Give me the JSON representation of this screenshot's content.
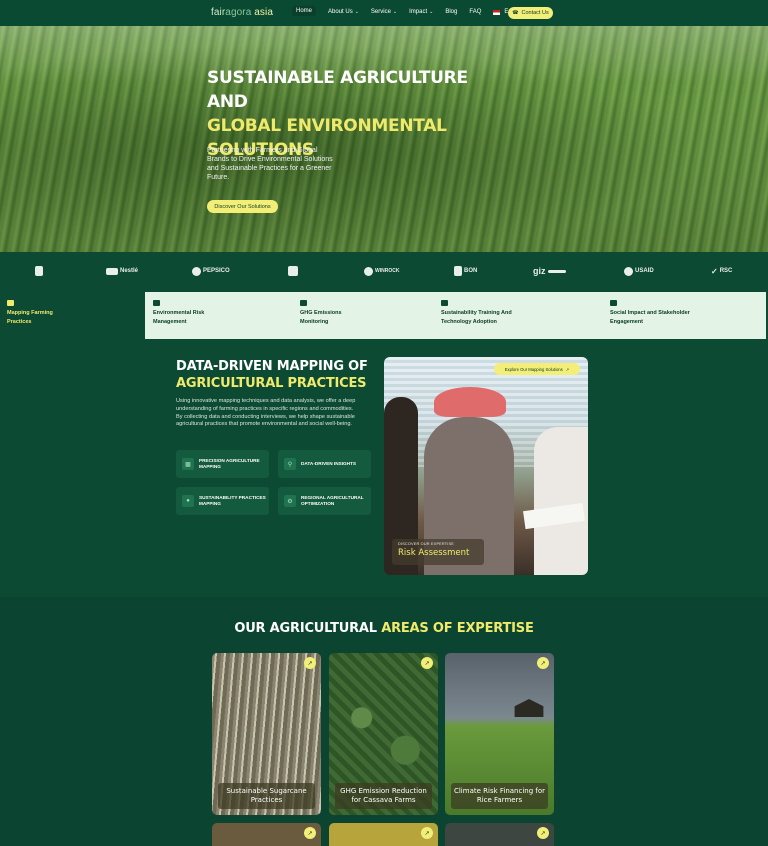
{
  "nav": {
    "logo": {
      "a": "fair",
      "b": "agora",
      "c": " asia"
    },
    "items": [
      {
        "label": "Home",
        "has_menu": false
      },
      {
        "label": "About Us",
        "has_menu": true
      },
      {
        "label": "Service",
        "has_menu": true
      },
      {
        "label": "Impact",
        "has_menu": true
      },
      {
        "label": "Blog",
        "has_menu": false
      },
      {
        "label": "FAQ",
        "has_menu": false
      },
      {
        "label": "English",
        "has_menu": true
      }
    ],
    "contact_label": "Contact Us",
    "chevron": "⌄"
  },
  "hero": {
    "title_line1": "SUSTAINABLE AGRICULTURE AND",
    "title_highlight": "GLOBAL ENVIRONMENTAL SOLUTIONS",
    "subtitle": "Partnering with Farmers and Global Brands to Drive Environmental Solutions and Sustainable Practices for a Greener Future.",
    "cta_label": "Discover Our Solutions"
  },
  "partners": [
    {
      "label": "",
      "icon": "panda-logo-icon"
    },
    {
      "label": "Nestlé",
      "icon": "nestle-logo-icon"
    },
    {
      "label": "PEPSICO",
      "icon": "pepsico-logo-icon"
    },
    {
      "label": "",
      "icon": "partner-logo-icon"
    },
    {
      "label": "WINROCK",
      "icon": "winrock-logo-icon"
    },
    {
      "label": "BON",
      "icon": "bonsucro-logo-icon"
    },
    {
      "label": "giz",
      "icon": "giz-logo-icon"
    },
    {
      "label": "USAID",
      "icon": "usaid-logo-icon"
    },
    {
      "label": "RSC",
      "icon": "rsc-logo-icon"
    }
  ],
  "tabs": [
    {
      "label": "Mapping Farming Practices",
      "active": true
    },
    {
      "label": "Environmental Risk Management",
      "active": false
    },
    {
      "label": "GHG Emissions Monitoring",
      "active": false
    },
    {
      "label": "Sustainability Training And Technology Adoption",
      "active": false
    },
    {
      "label": "Social Impact and Stakeholder Engagement",
      "active": false
    }
  ],
  "mapping": {
    "title_line1": "DATA-DRIVEN MAPPING OF",
    "title_highlight": "AGRICULTURAL PRACTICES",
    "description": "Using innovative mapping techniques and data analysis, we offer a deep understanding of farming practices in specific regions and commodities. By collecting data and conducting interviews, we help shape sustainable agricultural practices that promote environmental and social well-being.",
    "features": [
      {
        "label": "PRECISION AGRICULTURE MAPPING",
        "icon": "chart-icon"
      },
      {
        "label": "DATA-DRIVEN INSIGHTS",
        "icon": "search-icon"
      },
      {
        "label": "SUSTAINABILITY PRACTICES MAPPING",
        "icon": "people-icon"
      },
      {
        "label": "REGIONAL AGRICULTURAL OPTIMIZATION",
        "icon": "gear-icon"
      }
    ],
    "photo": {
      "explore_label": "Explore Our Mapping Solutions",
      "caption_small": "DISCOVER OUR EXPERTISE",
      "caption_big": "Risk Assessment"
    }
  },
  "expertise": {
    "title_plain": "OUR AGRICULTURAL ",
    "title_highlight": "AREAS OF EXPERTISE",
    "cards": [
      {
        "label": "Sustainable Sugarcane Practices"
      },
      {
        "label": "GHG Emission Reduction for Cassava Farms"
      },
      {
        "label": "Climate Risk Financing for Rice Farmers"
      }
    ]
  },
  "colors": {
    "primary_green": "#0d4a33",
    "accent_yellow": "#f2ee77",
    "highlight_text": "#f0ea6c",
    "tab_background": "#e3f3e6"
  }
}
